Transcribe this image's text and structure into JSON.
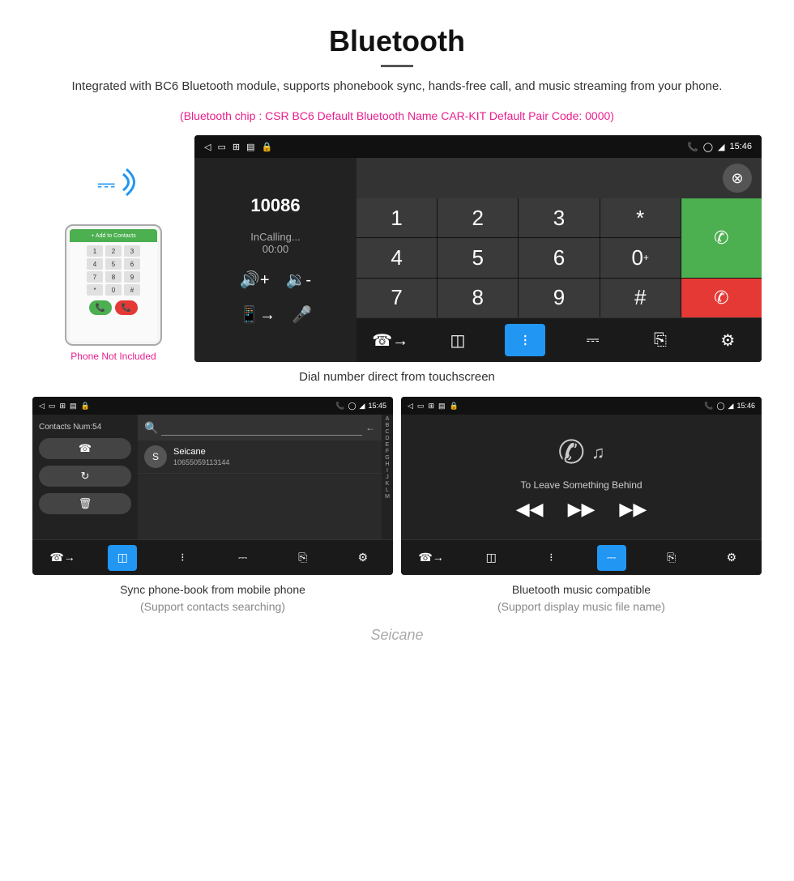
{
  "header": {
    "title": "Bluetooth",
    "description": "Integrated with BC6 Bluetooth module, supports phonebook sync, hands-free call, and music streaming from your phone.",
    "specs": "(Bluetooth chip : CSR BC6    Default Bluetooth Name CAR-KIT    Default Pair Code: 0000)"
  },
  "main_screen": {
    "status_bar": {
      "left_icons": [
        "back-icon",
        "window-icon",
        "grid-icon",
        "sim-icon",
        "lock-icon"
      ],
      "right_icons": [
        "phone-icon",
        "location-icon",
        "wifi-icon"
      ],
      "time": "15:46"
    },
    "dial": {
      "number": "10086",
      "status": "InCalling...",
      "time": "00:00",
      "keys": [
        "1",
        "2",
        "3",
        "*",
        "4",
        "5",
        "6",
        "0+",
        "7",
        "8",
        "9",
        "#"
      ],
      "call_green_icon": "📞",
      "call_red_icon": "📞"
    },
    "bottom_bar": {
      "items": [
        "phone-transfer",
        "contacts",
        "dialpad",
        "bluetooth",
        "phone-out",
        "settings"
      ]
    }
  },
  "main_caption": "Dial number direct from touchscreen",
  "phone_not_included": "Phone Not Included",
  "contacts_screen": {
    "status_bar": {
      "time": "15:45"
    },
    "contacts_num": "Contacts Num:54",
    "contact": {
      "name": "Seicane",
      "phone": "10655059113144"
    },
    "alphabet": [
      "A",
      "B",
      "C",
      "D",
      "E",
      "F",
      "G",
      "H",
      "I",
      "J",
      "K",
      "L",
      "M"
    ]
  },
  "music_screen": {
    "status_bar": {
      "time": "15:46"
    },
    "song_title": "To Leave Something Behind"
  },
  "captions": {
    "contacts": "Sync phone-book from mobile phone\n(Support contacts searching)",
    "music": "Bluetooth music compatible\n(Support display music file name)"
  },
  "watermark": "Seicane"
}
